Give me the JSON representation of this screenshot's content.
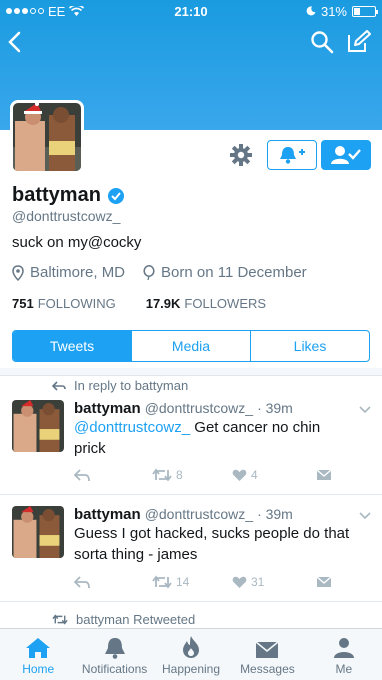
{
  "status_bar": {
    "carrier": "EE",
    "time": "21:10",
    "battery_percent": "31%",
    "battery_level": 0.31
  },
  "profile": {
    "display_name": "battyman",
    "handle": "@donttrustcowz_",
    "bio": "suck on my@cocky",
    "location": "Baltimore, MD",
    "birthday": "Born on 11 December",
    "following_count": "751",
    "following_label": "FOLLOWING",
    "followers_count": "17.9K",
    "followers_label": "FOLLOWERS"
  },
  "tabs": [
    "Tweets",
    "Media",
    "Likes"
  ],
  "tweets": [
    {
      "context": "In reply to battyman",
      "name": "battyman",
      "handle": "@donttrustcowz_",
      "time": "· 39m",
      "mention": "@donttrustcowz_",
      "text": " Get cancer no chin prick",
      "retweets": "8",
      "likes": "4"
    },
    {
      "name": "battyman",
      "handle": "@donttrustcowz_",
      "time": "· 39m",
      "text": "Guess I got hacked, sucks people do that sorta thing - james",
      "retweets": "14",
      "likes": "31"
    }
  ],
  "retweet_context": "battyman Retweeted",
  "tabbar": [
    "Home",
    "Notifications",
    "Happening",
    "Messages",
    "Me"
  ],
  "colors": {
    "accent": "#1da1f2",
    "banner": "#1a9be0",
    "muted": "#657786"
  }
}
